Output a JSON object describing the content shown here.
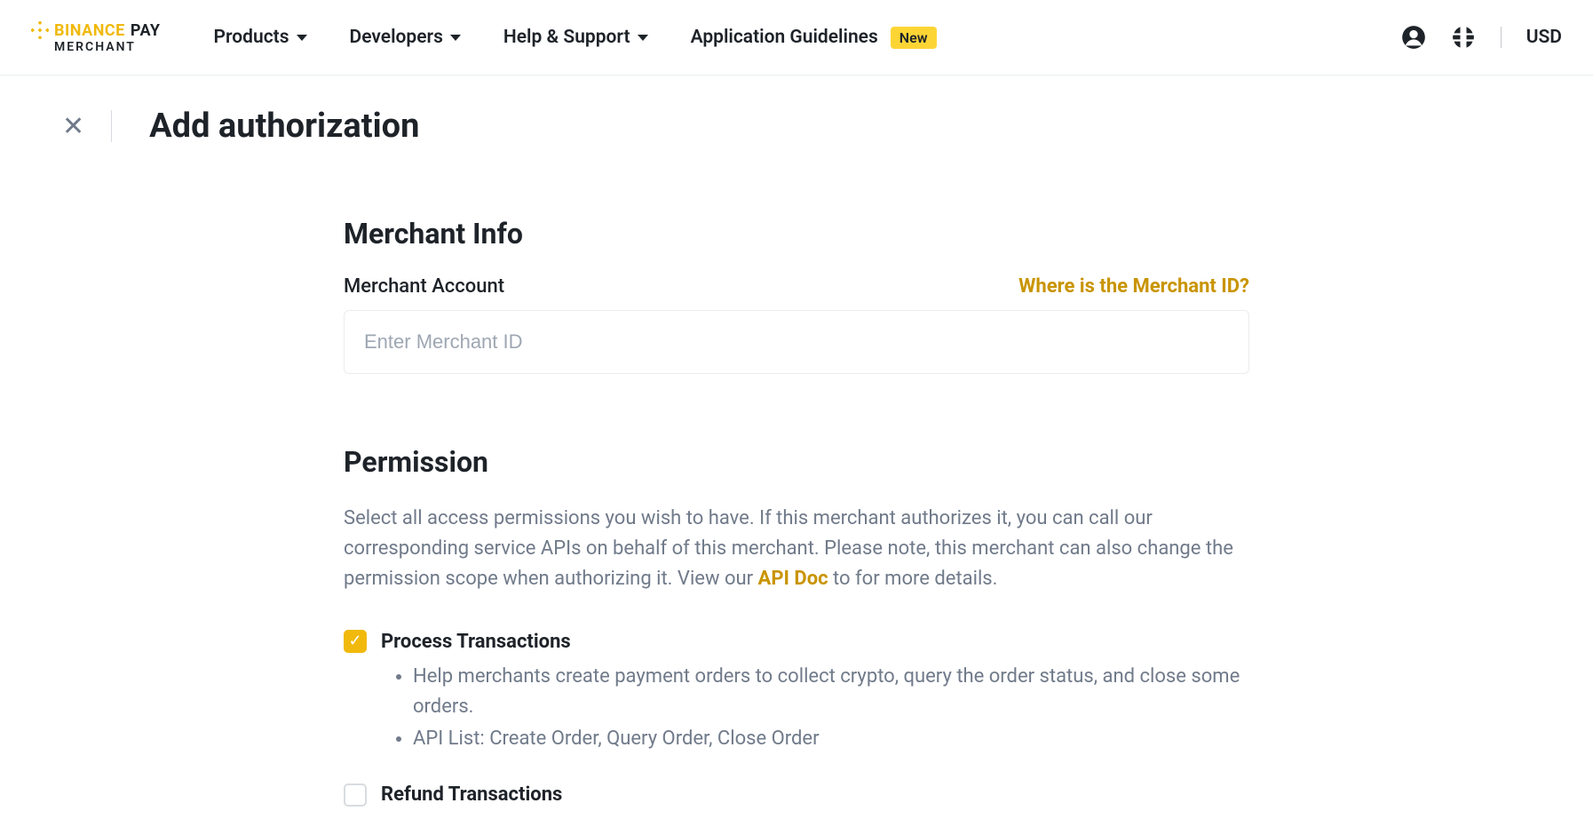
{
  "header": {
    "logo_brand": "BINANCE",
    "logo_product": "PAY",
    "logo_sub": "MERCHANT",
    "nav": {
      "products": "Products",
      "developers": "Developers",
      "help": "Help & Support",
      "guidelines": "Application Guidelines",
      "guidelines_badge": "New"
    },
    "currency": "USD"
  },
  "page": {
    "title": "Add authorization"
  },
  "merchant_info": {
    "section_title": "Merchant Info",
    "account_label": "Merchant Account",
    "help_link": "Where is the Merchant ID?",
    "input_placeholder": "Enter Merchant ID",
    "input_value": ""
  },
  "permission": {
    "section_title": "Permission",
    "description_prefix": "Select all access permissions you wish to have. If this merchant authorizes it, you can call our corresponding service APIs on behalf of this merchant. Please note, this merchant can also change the permission scope when authorizing it. View our ",
    "api_doc_link": "API Doc",
    "description_suffix": " to for more details.",
    "items": [
      {
        "title": "Process Transactions",
        "checked": true,
        "bullets": [
          "Help merchants create payment orders to collect crypto, query the order status, and close some orders.",
          "API List: Create Order, Query Order, Close Order"
        ]
      },
      {
        "title": "Refund Transactions",
        "checked": false,
        "bullets": []
      }
    ]
  }
}
